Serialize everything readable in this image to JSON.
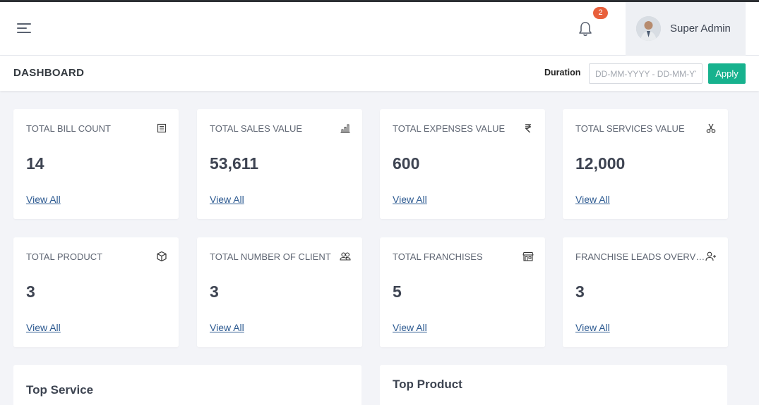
{
  "header": {
    "notification_count": "2",
    "user_name": "Super Admin"
  },
  "subheader": {
    "title": "DASHBOARD",
    "duration_label": "Duration",
    "date_placeholder": "DD-MM-YYYY - DD-MM-YYYY",
    "apply_label": "Apply"
  },
  "cards": [
    {
      "label": "TOTAL BILL COUNT",
      "value": "14",
      "link": "View All",
      "icon": "bill-icon"
    },
    {
      "label": "TOTAL SALES VALUE",
      "value": "53,611",
      "link": "View All",
      "icon": "bar-chart-icon"
    },
    {
      "label": "TOTAL EXPENSES VALUE",
      "value": "600",
      "link": "View All",
      "icon": "rupee-icon"
    },
    {
      "label": "TOTAL SERVICES VALUE",
      "value": "12,000",
      "link": "View All",
      "icon": "scissors-icon"
    },
    {
      "label": "TOTAL PRODUCT",
      "value": "3",
      "link": "View All",
      "icon": "box-icon"
    },
    {
      "label": "TOTAL NUMBER OF CLIENT",
      "value": "3",
      "link": "View All",
      "icon": "users-icon"
    },
    {
      "label": "TOTAL FRANCHISES",
      "value": "5",
      "link": "View All",
      "icon": "store-icon"
    },
    {
      "label": "FRANCHISE LEADS OVERVIEW",
      "value": "3",
      "link": "View All",
      "icon": "user-plus-icon"
    }
  ],
  "panels": {
    "top_service_title": "Top Service",
    "top_product_title": "Top Product"
  }
}
